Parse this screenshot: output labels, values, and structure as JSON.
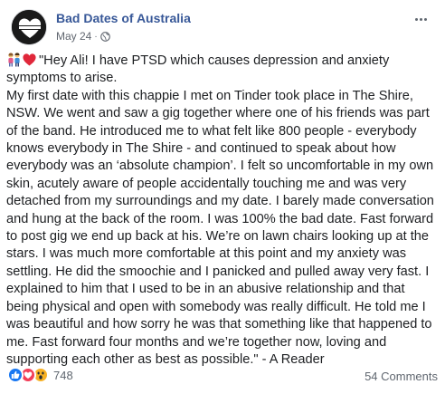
{
  "post": {
    "page_name": "Bad Dates of Australia",
    "avatar_text": "Bad Dates of Australia",
    "timestamp": "May 24",
    "separator": "·",
    "privacy_icon": "globe-icon",
    "more_icon": "more-options-icon",
    "body_lines": [
      "\"Hey Ali! I have PTSD which causes depression and anxiety",
      "symptoms to arise.",
      "My first date with this chappie I met on Tinder took place in The Shire,",
      "NSW. We went and saw a gig together where one of his friends was part",
      "of the band. He introduced me to what felt like 800 people - everybody",
      "knows everybody in The Shire - and continued to speak about how",
      "everybody was an ‘absolute champion’. I felt so uncomfortable in my own",
      "skin, acutely aware of people accidentally touching me and was very",
      "detached from my surroundings and my date. I barely made conversation",
      "and hung at the back of the room. I was 100% the bad date. Fast forward",
      "to post gig we end up back at his. We’re on lawn chairs looking up at the",
      "stars. I was much more comfortable at this point and my anxiety was",
      "settling. He did the smoochie and I panicked and pulled away very fast. I",
      "explained to him that I used to be in an abusive relationship and that",
      "being physical and open with somebody was really difficult. He told me I",
      "was beautiful and how sorry he was that something like that happened to",
      "me. Fast forward four months and we’re together now, loving and",
      "supporting each other as best as possible.\" - A Reader"
    ],
    "lead_emoji": [
      "couple-icon",
      "red-heart-icon"
    ],
    "reaction_icons": [
      "like-icon",
      "love-icon",
      "wow-icon"
    ],
    "reaction_count": "748",
    "comments_label": "54 Comments"
  },
  "colors": {
    "page_name": "#385898",
    "meta": "#616770",
    "body": "#1c1e21",
    "like": "#1877f2",
    "love": "#f33e58",
    "wow": "#f7b125"
  }
}
